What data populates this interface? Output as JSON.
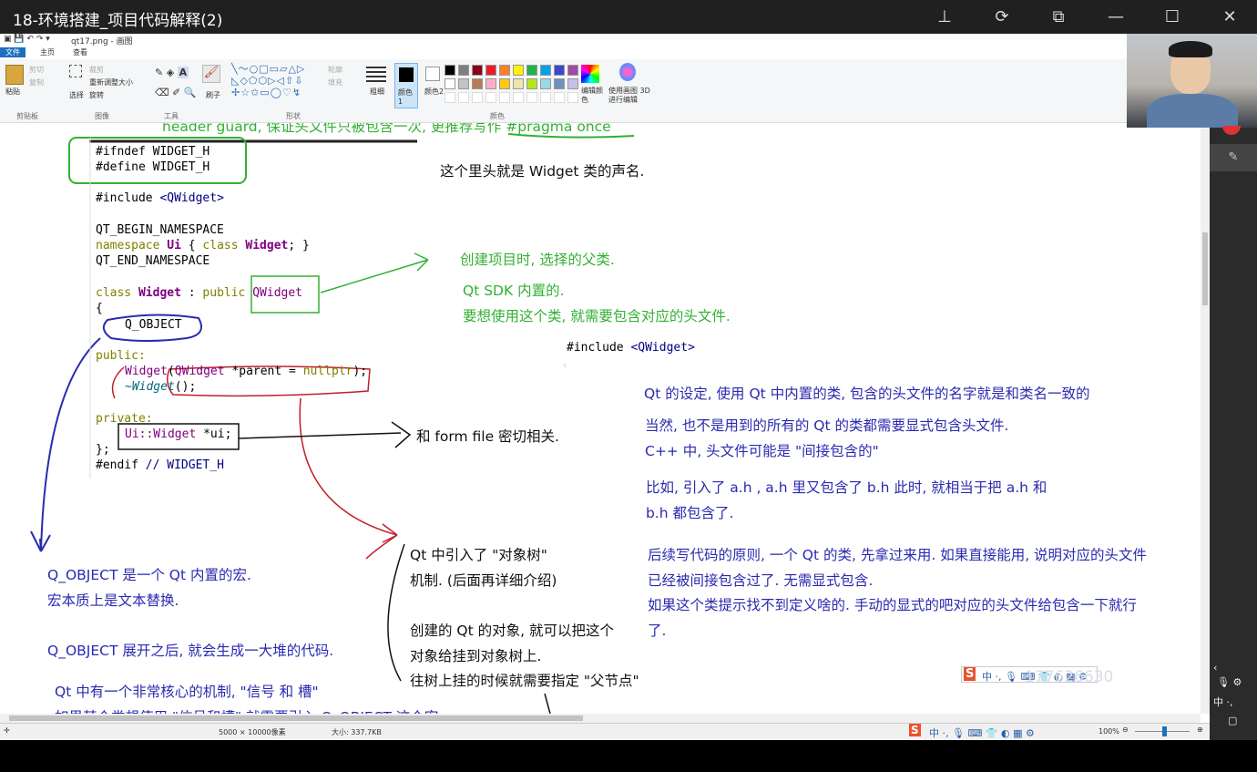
{
  "window": {
    "title": "18-环境搭建_项目代码解释(2)"
  },
  "paint": {
    "file_name": "qt17.png - 画图",
    "tabs": [
      "文件",
      "主页",
      "查看"
    ],
    "ribbon": {
      "paste": "粘贴",
      "cut": "剪切",
      "copy": "复制",
      "select": "选择",
      "crop": "裁剪",
      "resize": "重新调整大小",
      "rotate": "旋转",
      "brush": "刷子",
      "outline": "轮廓",
      "fill": "填充",
      "size": "粗细",
      "color1": "颜色1",
      "color2": "颜色2",
      "edit_colors": "编辑颜色",
      "paint3d": "使用画图 3D 进行编辑",
      "groups": [
        "剪贴板",
        "图像",
        "工具",
        "形状",
        "颜色"
      ],
      "palette_colors": [
        "#000000",
        "#7f7f7f",
        "#880015",
        "#ed1c24",
        "#ff7f27",
        "#fff200",
        "#22b14c",
        "#00a2e8",
        "#3f48cc",
        "#a349a4",
        "#ffffff",
        "#c3c3c3",
        "#b97a57",
        "#ffaec9",
        "#ffc90e",
        "#efe4b0",
        "#b5e61d",
        "#99d9ea",
        "#7092be",
        "#c8bfe7"
      ]
    }
  },
  "code": {
    "l1": "#ifndef WIDGET_H",
    "l2": "#define WIDGET_H",
    "l3a": "#include ",
    "l3b": "<QWidget>",
    "l4": "QT_BEGIN_NAMESPACE",
    "l5a": "namespace ",
    "l5b": "Ui",
    "l5c": " { ",
    "l5d": "class ",
    "l5e": "Widget",
    "l5f": "; }",
    "l6": "QT_END_NAMESPACE",
    "l7a": "class ",
    "l7b": "Widget",
    "l7c": " : ",
    "l7d": "public ",
    "l7e": "QWidget",
    "l8": "{",
    "l9": "Q_OBJECT",
    "l10": "public:",
    "l11a": "Widget",
    "l11b": "(",
    "l11c": "QWidget",
    "l11d": " *parent = ",
    "l11e": "nullptr",
    "l11f": ");",
    "l12a": "~Widget",
    "l12b": "();",
    "l13": "private:",
    "l14a": "Ui::Widget",
    "l14b": " *ui;",
    "l15": "};",
    "l16a": "#endif ",
    "l16b": "// WIDGET_H",
    "inc2a": "#include ",
    "inc2b": "<QWidget>"
  },
  "notes": {
    "header_guard": "header guard, 保证头文件只被包含一次, 更推荐写作 #pragma once",
    "widget_decl": "这个里头就是 Widget 类的声名.",
    "parent_class": "创建项目时, 选择的父类.",
    "qt_sdk": "Qt SDK 内置的.",
    "include_header": "要想使用这个类, 就需要包含对应的头文件.",
    "header_rule": "Qt 的设定, 使用 Qt 中内置的类, 包含的头文件的名字就是和类名一致的",
    "not_all": "当然, 也不是用到的所有的 Qt 的类都需要显式包含头文件.",
    "indirect": "C++ 中, 头文件可能是 \"间接包含的\"",
    "example1": "比如, 引入了 a.h , a.h 里又包含了 b.h 此时, 就相当于把 a.h 和",
    "example2": "b.h 都包含了.",
    "principle1": "后续写代码的原则, 一个 Qt 的类, 先拿过来用. 如果直接能用, 说明对应的头文件",
    "principle2": "已经被间接包含过了. 无需显式包含.",
    "principle3": "如果这个类提示找不到定义啥的. 手动的显式的吧对应的头文件给包含一下就行",
    "principle4": "了.",
    "form_file": "和 form file 密切相关.",
    "tree1": "Qt 中引入了 \"对象树\"",
    "tree2": "机制. (后面再详细介绍)",
    "tree3": "创建的 Qt 的对象, 就可以把这个",
    "tree4": "对象给挂到对象树上.",
    "tree5": "往树上挂的时候就需要指定 \"父节点\"",
    "qobj1": "Q_OBJECT 是一个 Qt 内置的宏.",
    "qobj2": "宏本质上是文本替换.",
    "qobj3": "Q_OBJECT 展开之后, 就会生成一大堆的代码.",
    "signals": "Qt 中有一个非常核心的机制, \"信号 和 槽\"",
    "signals2": "如果某个类想使用 \"信号和槽\" 就需要引入 Q_OBJECT 这个宏."
  },
  "ime": {
    "status": "中 ·, 🎙 ⌨ 👕 ◐ ▦ ⚙",
    "watermark": "177626630"
  },
  "status": {
    "dimensions": "5000 × 10000像素",
    "size": "大小: 337.7KB",
    "zoom": "100%"
  },
  "panel": {
    "ime": "中 ·,"
  }
}
